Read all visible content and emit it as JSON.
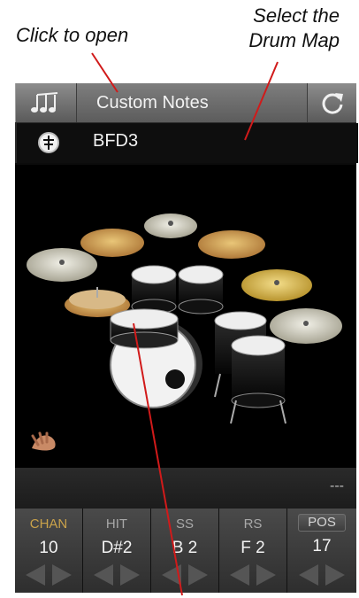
{
  "annotations": {
    "click_to_open": "Click to open",
    "select_line1": "Select the",
    "select_line2": "Drum Map"
  },
  "toolbar": {
    "notes_icon": "music-notes-icon",
    "title": "Custom Notes",
    "refresh_icon": "refresh-icon"
  },
  "kit": {
    "icon": "kit-selector-icon",
    "name": "BFD3"
  },
  "midi_display": "---",
  "params": [
    {
      "label": "CHAN",
      "value": "10"
    },
    {
      "label": "HIT",
      "value": "D#2"
    },
    {
      "label": "SS",
      "value": "B 2"
    },
    {
      "label": "RS",
      "value": "F 2"
    },
    {
      "label": "POS",
      "value": "17"
    }
  ],
  "colors": {
    "panel": "#0b0b0b",
    "toolbar": "#6e6e6e",
    "chan_accent": "#caa24a",
    "annotation_line": "#d11a1a"
  }
}
